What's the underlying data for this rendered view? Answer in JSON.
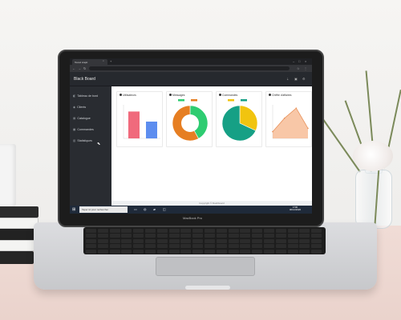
{
  "scene": {
    "laptop_brand": "MacBook Pro"
  },
  "browser": {
    "tab_title": "Tocod crapit",
    "tab_close": "×",
    "new_tab": "+"
  },
  "app": {
    "title": "Black Board",
    "sidebar": {
      "items": [
        {
          "label": "Tableau de bord",
          "icon": "dashboard-icon"
        },
        {
          "label": "Clients",
          "icon": "users-icon"
        },
        {
          "label": "Catalogue",
          "icon": "catalog-icon"
        },
        {
          "label": "Commandes",
          "icon": "orders-icon"
        },
        {
          "label": "Statistiques",
          "icon": "stats-icon"
        }
      ]
    },
    "footer": "Copyright © Dashboard"
  },
  "taskbar": {
    "search_placeholder": "Taper ici pour rechercher",
    "time": "1730",
    "date": "06/12/2020"
  },
  "chart_data": [
    {
      "type": "bar",
      "title": "Utilisateurs",
      "categories": [
        "",
        ""
      ],
      "values": [
        8,
        5
      ],
      "ylim": [
        0,
        10
      ],
      "colors": [
        "#f06a7c",
        "#5d8def"
      ]
    },
    {
      "type": "pie",
      "title": "Messages",
      "donut": true,
      "values": [
        42,
        58
      ],
      "colors": [
        "#2ecc71",
        "#e67e22"
      ]
    },
    {
      "type": "pie",
      "title": "Commandes",
      "donut": false,
      "values": [
        32,
        68
      ],
      "colors": [
        "#f1c40f",
        "#16a085"
      ]
    },
    {
      "type": "area",
      "title": "Chiffre d'affaires",
      "x": [
        0,
        1,
        2,
        3
      ],
      "values": [
        2,
        6,
        9,
        3
      ],
      "ylim": [
        0,
        10
      ],
      "colors": [
        "#f6b48a"
      ]
    }
  ]
}
